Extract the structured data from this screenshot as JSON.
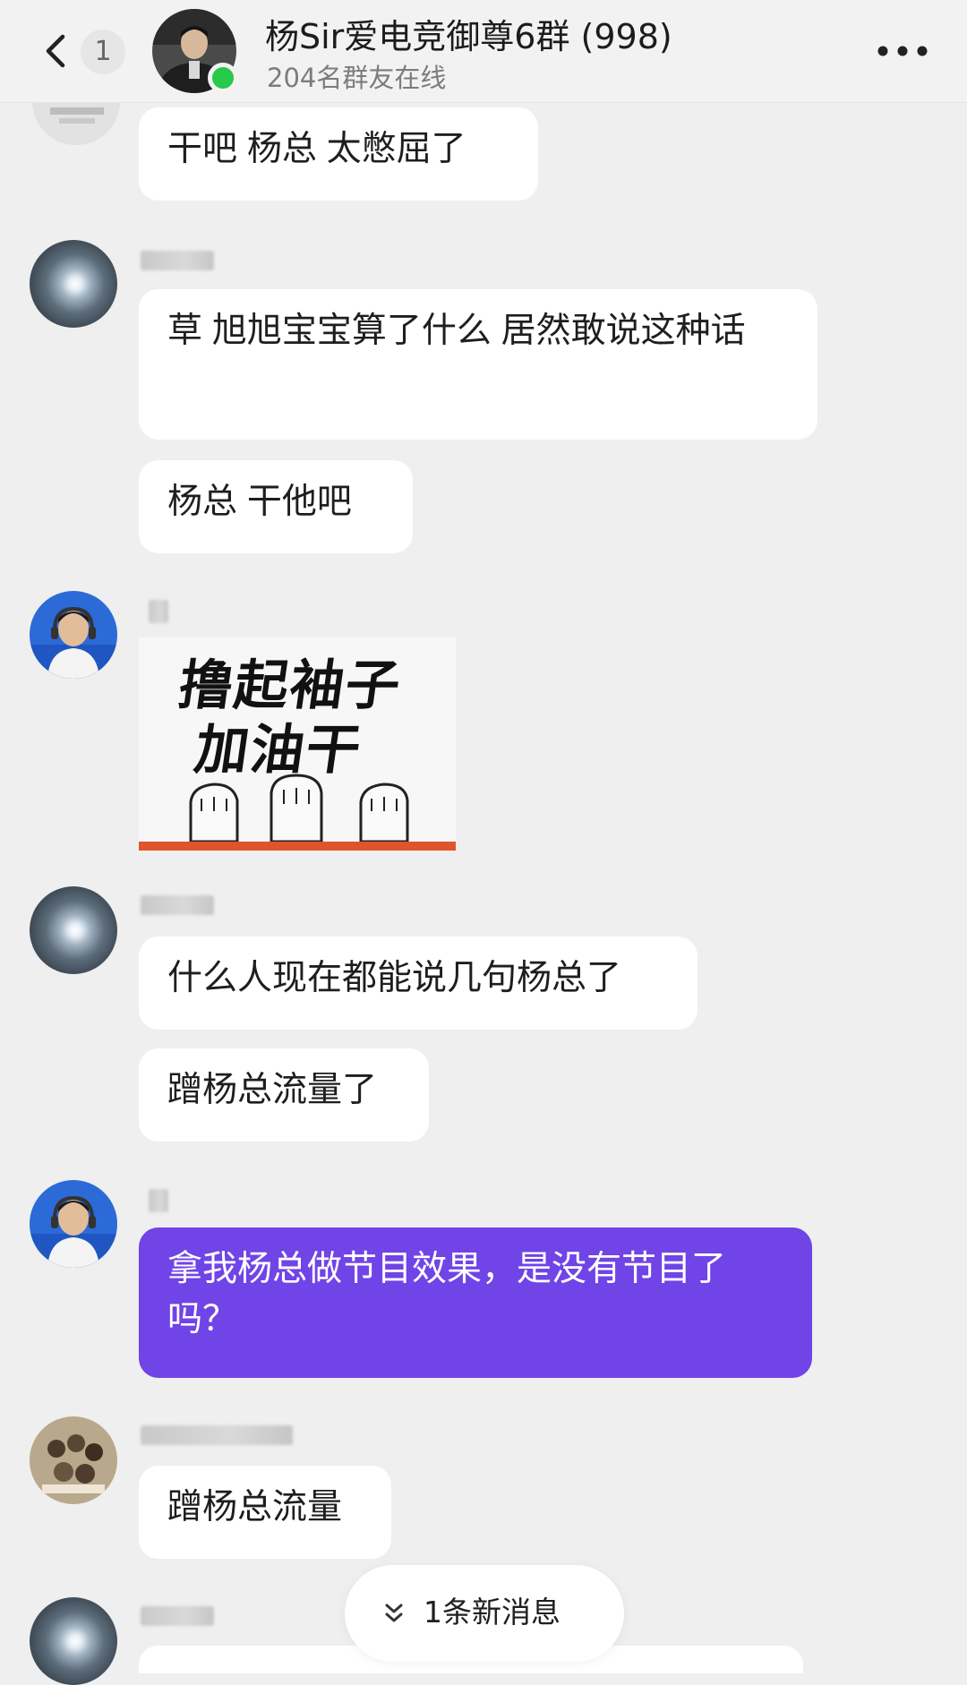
{
  "header": {
    "title": "杨Sir爱电竞御尊6群 (998)",
    "online": "204名群友在线",
    "unread_count": "1"
  },
  "messages": [
    {
      "text": "干吧 杨总  太憋屈了"
    },
    {
      "text": "草  旭旭宝宝算了什么  居然敢说这种话"
    },
    {
      "text": "杨总  干他吧"
    },
    {
      "sticker_text_line1": "撸起袖子",
      "sticker_text_line2": "加油干"
    },
    {
      "text": "什么人现在都能说几句杨总了"
    },
    {
      "text": "蹭杨总流量了"
    },
    {
      "text": "拿我杨总做节目效果，是没有节目了吗？"
    },
    {
      "text": "蹭杨总流量"
    }
  ],
  "new_messages_pill": {
    "label": "1条新消息",
    "icon": "double-chevron-down-icon"
  },
  "colors": {
    "highlight_bubble": "#7044e6",
    "online_dot": "#26c94a",
    "background": "#efefef"
  }
}
